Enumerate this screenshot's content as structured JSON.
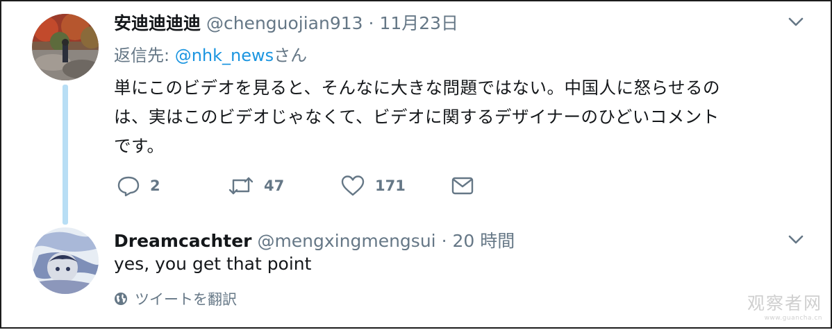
{
  "tweet1": {
    "name": "安迪迪迪迪",
    "handle": "@chenguojian913",
    "separator": "·",
    "time": "11月23日",
    "reply_prefix": "返信先: ",
    "reply_mention": "@nhk_news",
    "reply_suffix": "さん",
    "text_line1": "単にこのビデオを見ると、そんなに大きな問題ではない。中国人に怒らせるの",
    "text_line2": "は、実はこのビデオじゃなくて、ビデオに関するデザイナーのひどいコメント",
    "text_line3": "です。",
    "actions": {
      "reply_count": "2",
      "retweet_count": "47",
      "like_count": "171"
    },
    "icons": [
      "reply-icon",
      "retweet-icon",
      "like-icon",
      "direct-message-icon",
      "chevron-down-icon"
    ]
  },
  "tweet2": {
    "name": "Dreamcachter",
    "handle": "@mengxingmengsui",
    "separator": "·",
    "time": "20 時間",
    "text": "yes,  you get that point",
    "translate_label": "ツイートを翻訳",
    "icons": [
      "globe-icon",
      "chevron-down-icon"
    ]
  },
  "watermark": {
    "main": "观察者网",
    "url": "www.guancha.cn"
  },
  "colors": {
    "secondary_text": "#657786",
    "link": "#1b95e0",
    "thread_line": "#b8def5",
    "text": "#14171a"
  }
}
